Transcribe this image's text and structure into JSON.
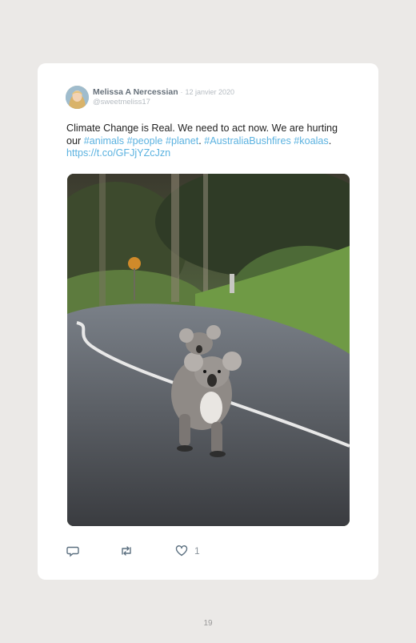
{
  "tweet": {
    "author_name": "Melissa A Nercessian",
    "separator": "·",
    "date": "12 janvier 2020",
    "handle": "@sweetmeliss17",
    "text_segments": {
      "s1": "Climate Change is Real. We need to act now. We are hurting our ",
      "h1": "#animals",
      "sp1": " ",
      "h2": "#people",
      "sp2": " ",
      "h3": "#planet",
      "p1": ". ",
      "h4": "#AustraliaBushfires",
      "sp3": " ",
      "h5": "#koalas",
      "p2": ". ",
      "link": "https://t.co/GFJjYZcJzn"
    },
    "image_description_icon": "koala-photo",
    "actions": {
      "reply_icon": "reply-icon",
      "retweet_icon": "retweet-icon",
      "like_icon": "heart-icon",
      "like_count": "1"
    }
  },
  "page": {
    "number": "19"
  },
  "colors": {
    "background": "#ebe9e7",
    "card": "#ffffff",
    "hashtag": "#5bb2e0",
    "name": "#66707a",
    "muted": "#b6bcc2"
  }
}
